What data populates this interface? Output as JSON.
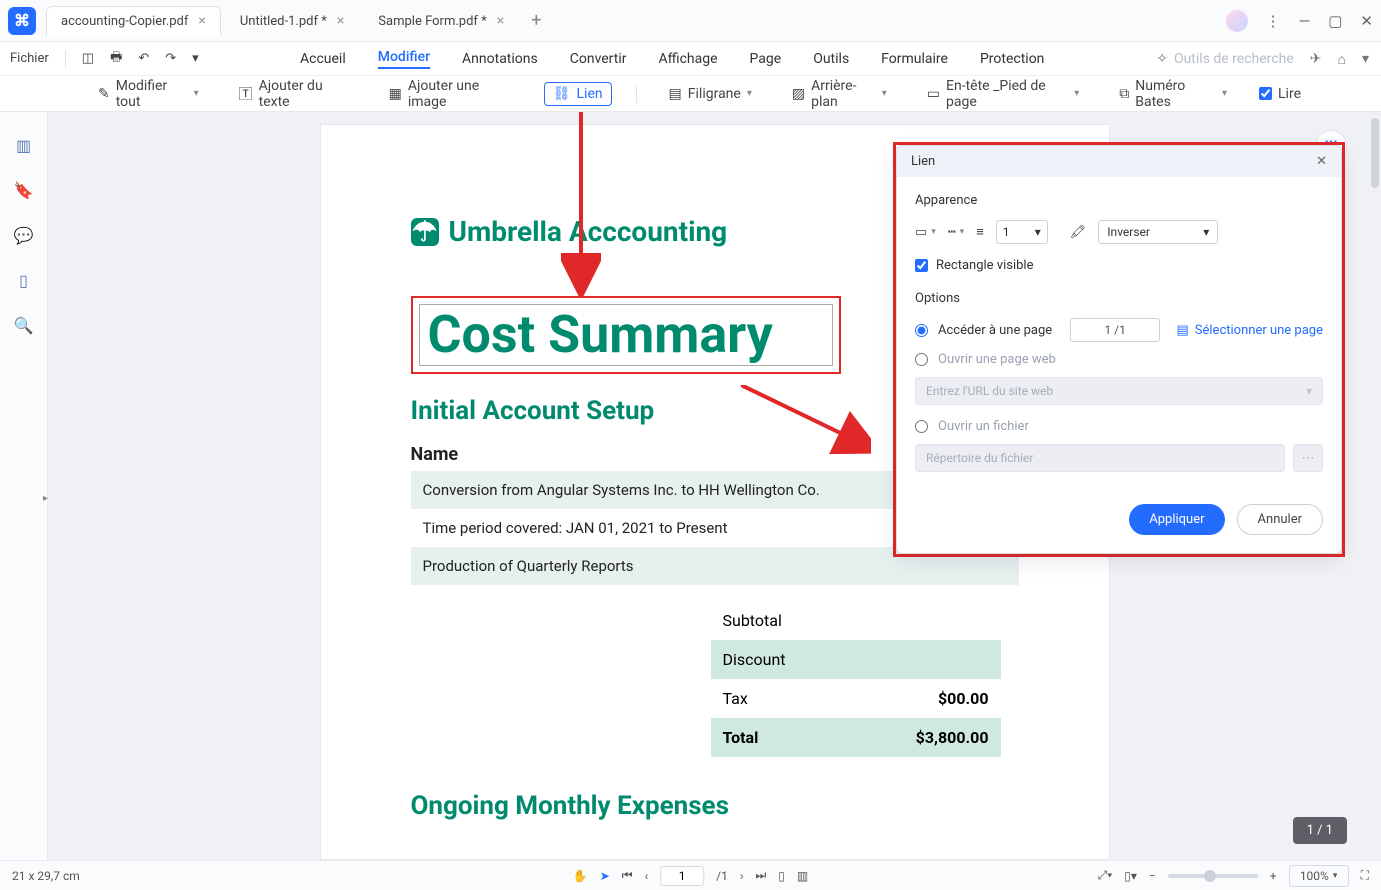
{
  "tabs": [
    {
      "label": "accounting-Copier.pdf"
    },
    {
      "label": "Untitled-1.pdf *"
    },
    {
      "label": "Sample Form.pdf *"
    }
  ],
  "menu": {
    "fichier": "Fichier",
    "items": [
      "Accueil",
      "Modifier",
      "Annotations",
      "Convertir",
      "Affichage",
      "Page",
      "Outils",
      "Formulaire",
      "Protection"
    ],
    "active": "Modifier",
    "search": "Outils de recherche"
  },
  "toolbar": {
    "modifier_tout": "Modifier tout",
    "ajouter_texte": "Ajouter du texte",
    "ajouter_image": "Ajouter une image",
    "lien": "Lien",
    "filigrane": "Filigrane",
    "arriere_plan": "Arrière-plan",
    "entete": "En-tête _Pied de page",
    "numero_bates": "Numéro Bates",
    "lire": "Lire"
  },
  "doc": {
    "brand": "Umbrella Acccounting",
    "title": "Cost Summary",
    "h_initial": "Initial Account Setup",
    "name_label": "Name",
    "rows": [
      "Conversion from Angular Systems Inc. to HH Wellington Co.",
      "Time period covered: JAN 01, 2021 to Present",
      "Production of Quarterly Reports"
    ],
    "totals": {
      "subtotal_l": "Subtotal",
      "discount_l": "Discount",
      "tax_l": "Tax",
      "tax_v": "$00.00",
      "total_l": "Total",
      "total_v": "$3,800.00"
    },
    "h_ongoing": "Ongoing Monthly Expenses"
  },
  "panel": {
    "title": "Lien",
    "sec_appearance": "Apparence",
    "thickness": "1",
    "invert": "Inverser",
    "rect_visible": "Rectangle visible",
    "sec_options": "Options",
    "goto_page": "Accéder à une page",
    "page_val": "1 /1",
    "select_page": "Sélectionner une page",
    "open_web": "Ouvrir une page web",
    "url_placeholder": "Entrez l'URL du site web",
    "open_file": "Ouvrir un fichier",
    "file_placeholder": "Répertoire du fichier",
    "apply": "Appliquer",
    "cancel": "Annuler"
  },
  "status": {
    "dims": "21 x 29,7 cm",
    "page_in": "1",
    "page_total": "/1",
    "zoom": "100%",
    "pagepill": "1 / 1"
  }
}
